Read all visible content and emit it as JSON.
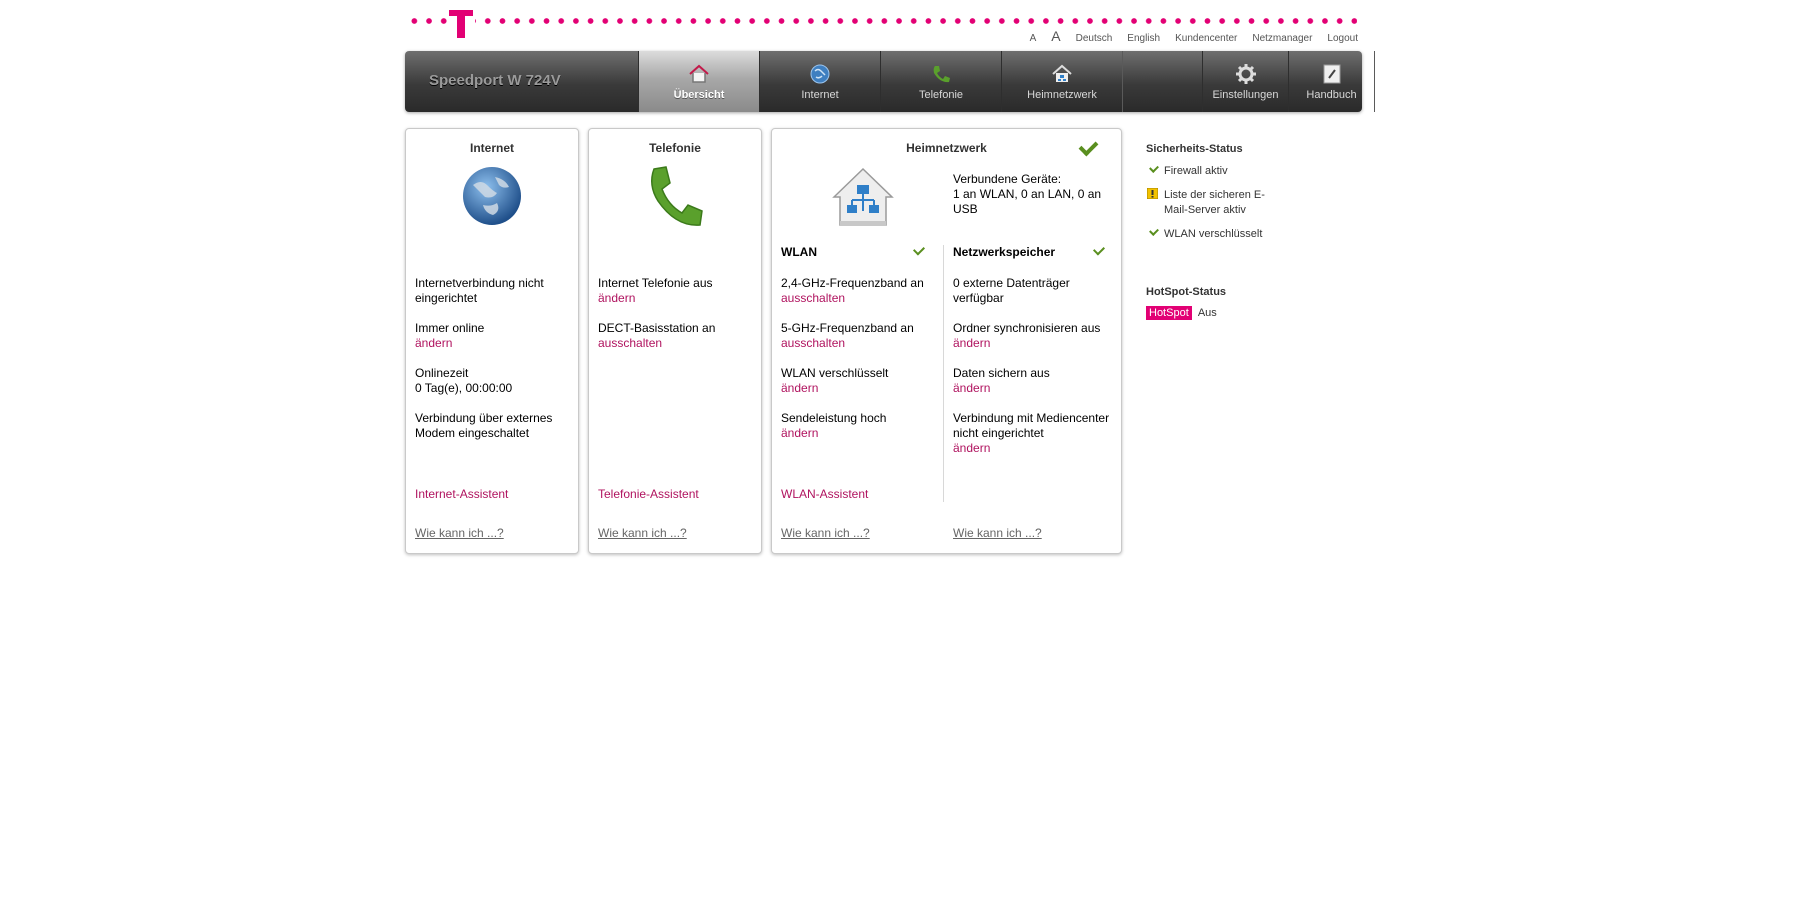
{
  "utility": {
    "font_small": "A",
    "font_large": "A",
    "lang_de": "Deutsch",
    "lang_en": "English",
    "kundencenter": "Kundencenter",
    "netzmanager": "Netzmanager",
    "logout": "Logout"
  },
  "nav": {
    "device": "Speedport W 724V",
    "tabs": [
      {
        "label": "Übersicht",
        "icon": "home-icon",
        "active": true
      },
      {
        "label": "Internet",
        "icon": "globe-icon"
      },
      {
        "label": "Telefonie",
        "icon": "phone-icon"
      },
      {
        "label": "Heimnetzwerk",
        "icon": "network-home-icon"
      },
      {
        "label": "Einstellungen",
        "icon": "gear-icon"
      },
      {
        "label": "Handbuch",
        "icon": "manual-icon"
      }
    ]
  },
  "internet": {
    "title": "Internet",
    "status1": "Internetverbindung nicht eingerichtet",
    "status2": "Immer online",
    "status2_link": "ändern",
    "onlinetime_label": "Onlinezeit",
    "onlinetime_value": "0 Tag(e), 00:00:00",
    "status4": "Verbindung über externes Modem eingeschaltet",
    "assistant": "Internet-Assistent",
    "how": "Wie kann ich ...?"
  },
  "telefonie": {
    "title": "Telefonie",
    "status1": "Internet Telefonie aus",
    "status1_link": "ändern",
    "status2": "DECT-Basisstation an",
    "status2_link": "ausschalten",
    "assistant": "Telefonie-Assistent",
    "how": "Wie kann ich ...?"
  },
  "heimnetzwerk": {
    "title": "Heimnetzwerk",
    "devices_label": "Verbundene Geräte:",
    "devices_value": "1 an WLAN, 0 an LAN, 0 an USB",
    "wlan": {
      "title": "WLAN",
      "item1": "2,4-GHz-Frequenzband an",
      "item1_link": "ausschalten",
      "item2": "5-GHz-Frequenzband an",
      "item2_link": "ausschalten",
      "item3": "WLAN verschlüsselt",
      "item3_link": "ändern",
      "item4": "Sendeleistung hoch",
      "item4_link": "ändern",
      "assistant": "WLAN-Assistent",
      "how": "Wie kann ich ...?"
    },
    "nas": {
      "title": "Netzwerkspeicher",
      "item1": "0 externe Datenträger verfügbar",
      "item2": "Ordner synchronisieren aus",
      "item2_link": "ändern",
      "item3": "Daten sichern aus",
      "item3_link": "ändern",
      "item4": "Verbindung mit Mediencenter nicht eingerichtet",
      "item4_link": "ändern",
      "how": "Wie kann ich ...?"
    }
  },
  "sidebar": {
    "security_title": "Sicherheits-Status",
    "firewall": "Firewall aktiv",
    "mailserver": "Liste der sicheren E-Mail-Server aktiv",
    "wlan": "WLAN verschlüsselt",
    "hotspot_title": "HotSpot-Status",
    "hotspot_badge": "HotSpot",
    "hotspot_state": "Aus"
  },
  "colors": {
    "brand_magenta": "#e20074",
    "link_color": "#b0135f",
    "check_green": "#5a8f1f"
  }
}
